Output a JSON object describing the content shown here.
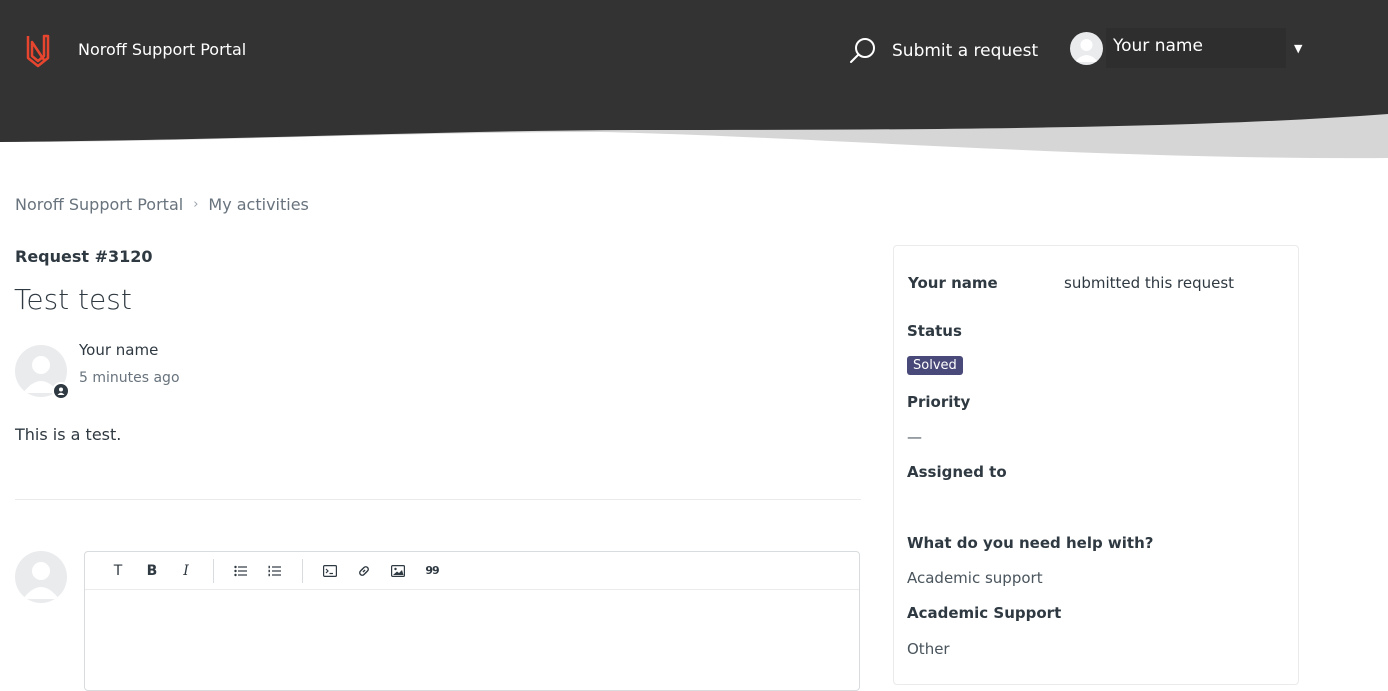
{
  "header": {
    "brand": "Noroff Support Portal",
    "submit_request": "Submit a request",
    "user_name": "Your name",
    "logo_color": "#e8452f",
    "icons": {
      "search": "search-icon",
      "caret": "caret-down-icon"
    }
  },
  "breadcrumb": {
    "items": [
      "Noroff Support Portal",
      "My activities"
    ],
    "separator": "›"
  },
  "request": {
    "id_label": "Request #3120",
    "title": "Test test",
    "author": "Your name",
    "time": "5 minutes ago",
    "body": "This is a test."
  },
  "editor": {
    "toolbar": {
      "text": "T",
      "bold": "B",
      "italic": "I",
      "quote": "99"
    }
  },
  "sidebar": {
    "submitter": "Your name",
    "submitted_text": "submitted this request",
    "status_label": "Status",
    "status_value": "Solved",
    "status_color": "#4a4a7a",
    "priority_label": "Priority",
    "priority_value": "—",
    "assigned_label": "Assigned to",
    "help_label": "What do you need help with?",
    "help_value": "Academic support",
    "academic_label": "Academic Support",
    "academic_value": "Other"
  }
}
